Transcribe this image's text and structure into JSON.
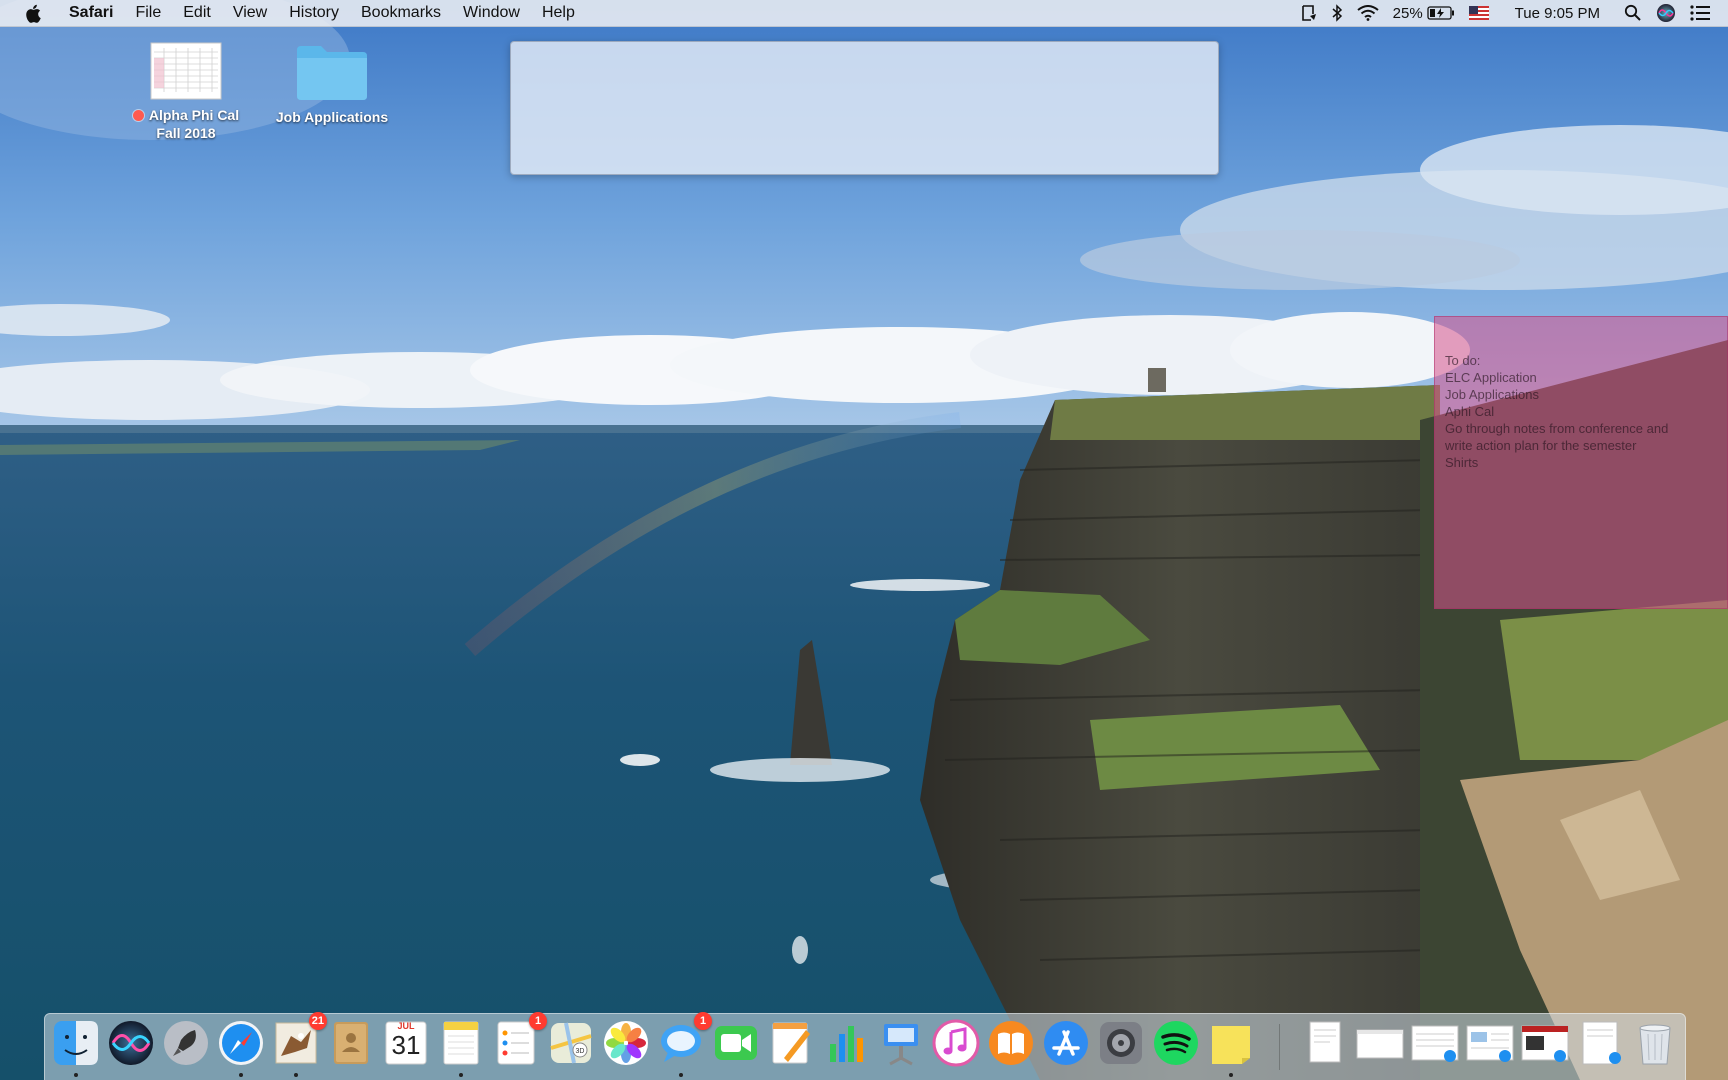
{
  "menubar": {
    "app_name": "Safari",
    "menus": [
      "File",
      "Edit",
      "View",
      "History",
      "Bookmarks",
      "Window",
      "Help"
    ],
    "battery_percent": "25%",
    "clock": "Tue 9:05 PM"
  },
  "desktop": {
    "icons": [
      {
        "label_line1": "Alpha Phi Cal",
        "label_line2": "Fall 2018",
        "tag_color": "#ff5a4f",
        "icon": "spreadsheet-document-icon"
      },
      {
        "label_line1": "Job Applications",
        "icon": "folder-icon"
      }
    ]
  },
  "sticky_note": {
    "lines": [
      "To do:",
      "ELC Application",
      "Job Applications",
      "Aphi Cal",
      "Go through notes from conference and",
      "write action plan for the semester",
      "Shirts"
    ],
    "color": "#d6528c"
  },
  "dock": {
    "mail_badge": "21",
    "reminders_badge": "1",
    "messages_badge": "1",
    "calendar_month": "JUL",
    "calendar_day": "31"
  }
}
